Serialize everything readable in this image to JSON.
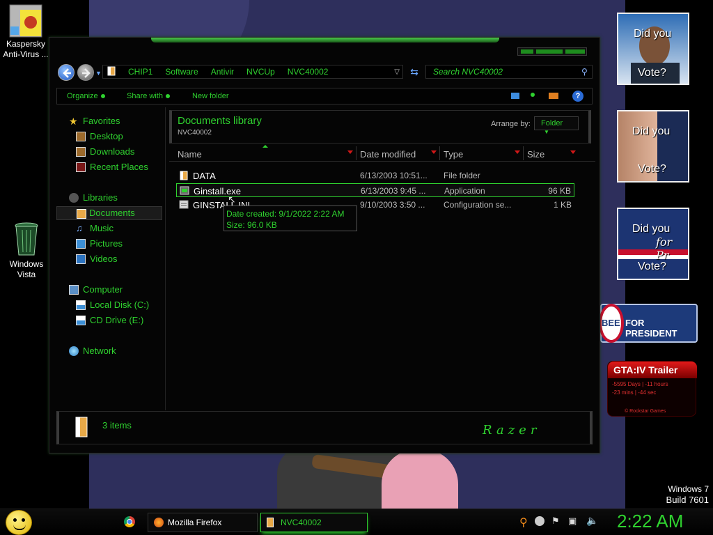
{
  "desktop": {
    "icons": [
      {
        "label": "Kaspersky Anti-Virus ..."
      },
      {
        "label": "Windows Vista"
      }
    ],
    "watermark": {
      "line1": "Windows 7",
      "line2": "Build 7601"
    }
  },
  "explorer": {
    "breadcrumbs": [
      "CHIP1",
      "Software",
      "Antivir",
      "NVCUp",
      "NVC40002"
    ],
    "search_placeholder": "Search NVC40002",
    "toolbar": {
      "organize": "Organize",
      "share_with": "Share with",
      "new_folder": "New folder"
    },
    "nav": {
      "favorites": "Favorites",
      "desktop": "Desktop",
      "downloads": "Downloads",
      "recent_places": "Recent Places",
      "libraries": "Libraries",
      "documents": "Documents",
      "music": "Music",
      "pictures": "Pictures",
      "videos": "Videos",
      "computer": "Computer",
      "local_disk": "Local Disk (C:)",
      "cd_drive": "CD Drive (E:)",
      "network": "Network"
    },
    "library": {
      "title": "Documents library",
      "subtitle": "NVC40002",
      "arrange_label": "Arrange by:",
      "arrange_value": "Folder"
    },
    "columns": {
      "name": "Name",
      "date": "Date modified",
      "type": "Type",
      "size": "Size"
    },
    "files": [
      {
        "name": "DATA",
        "date": "6/13/2003 10:51...",
        "type": "File folder",
        "size": ""
      },
      {
        "name": "Ginstall.exe",
        "date": "6/13/2003 9:45 ...",
        "type": "Application",
        "size": "96 KB"
      },
      {
        "name": "GINSTALL.INI",
        "date": "9/10/2003 3:50 ...",
        "type": "Configuration se...",
        "size": "1 KB"
      }
    ],
    "tooltip": {
      "line1": "Date created: 9/1/2022 2:22 AM",
      "line2": "Size: 96.0 KB"
    },
    "status": {
      "count": "3 items",
      "logo": "Razer"
    }
  },
  "gadgets": {
    "vote1": {
      "top": "Did you",
      "bottom": "Vote?"
    },
    "vote2": {
      "top": "Did you",
      "bottom": "Vote?"
    },
    "vote3": {
      "top": "Did you",
      "bottom": "Vote?",
      "script": "for Pr"
    },
    "huckabee": {
      "text": "FOR PRESIDENT",
      "name": "BEE"
    },
    "gta": {
      "title": "GTA:IV Trailer",
      "line1": "-5595 Days  |  -11 hours",
      "line2": "-23 mins  |  -44 sec",
      "footer": "© Rockstar Games"
    }
  },
  "taskbar": {
    "firefox": "Mozilla Firefox",
    "explorer": "NVC40002",
    "clock": "2:22 AM"
  },
  "colors": {
    "accent": "#2fd12f",
    "alert": "#d01818",
    "wallpaper": "#2e2f5c"
  }
}
